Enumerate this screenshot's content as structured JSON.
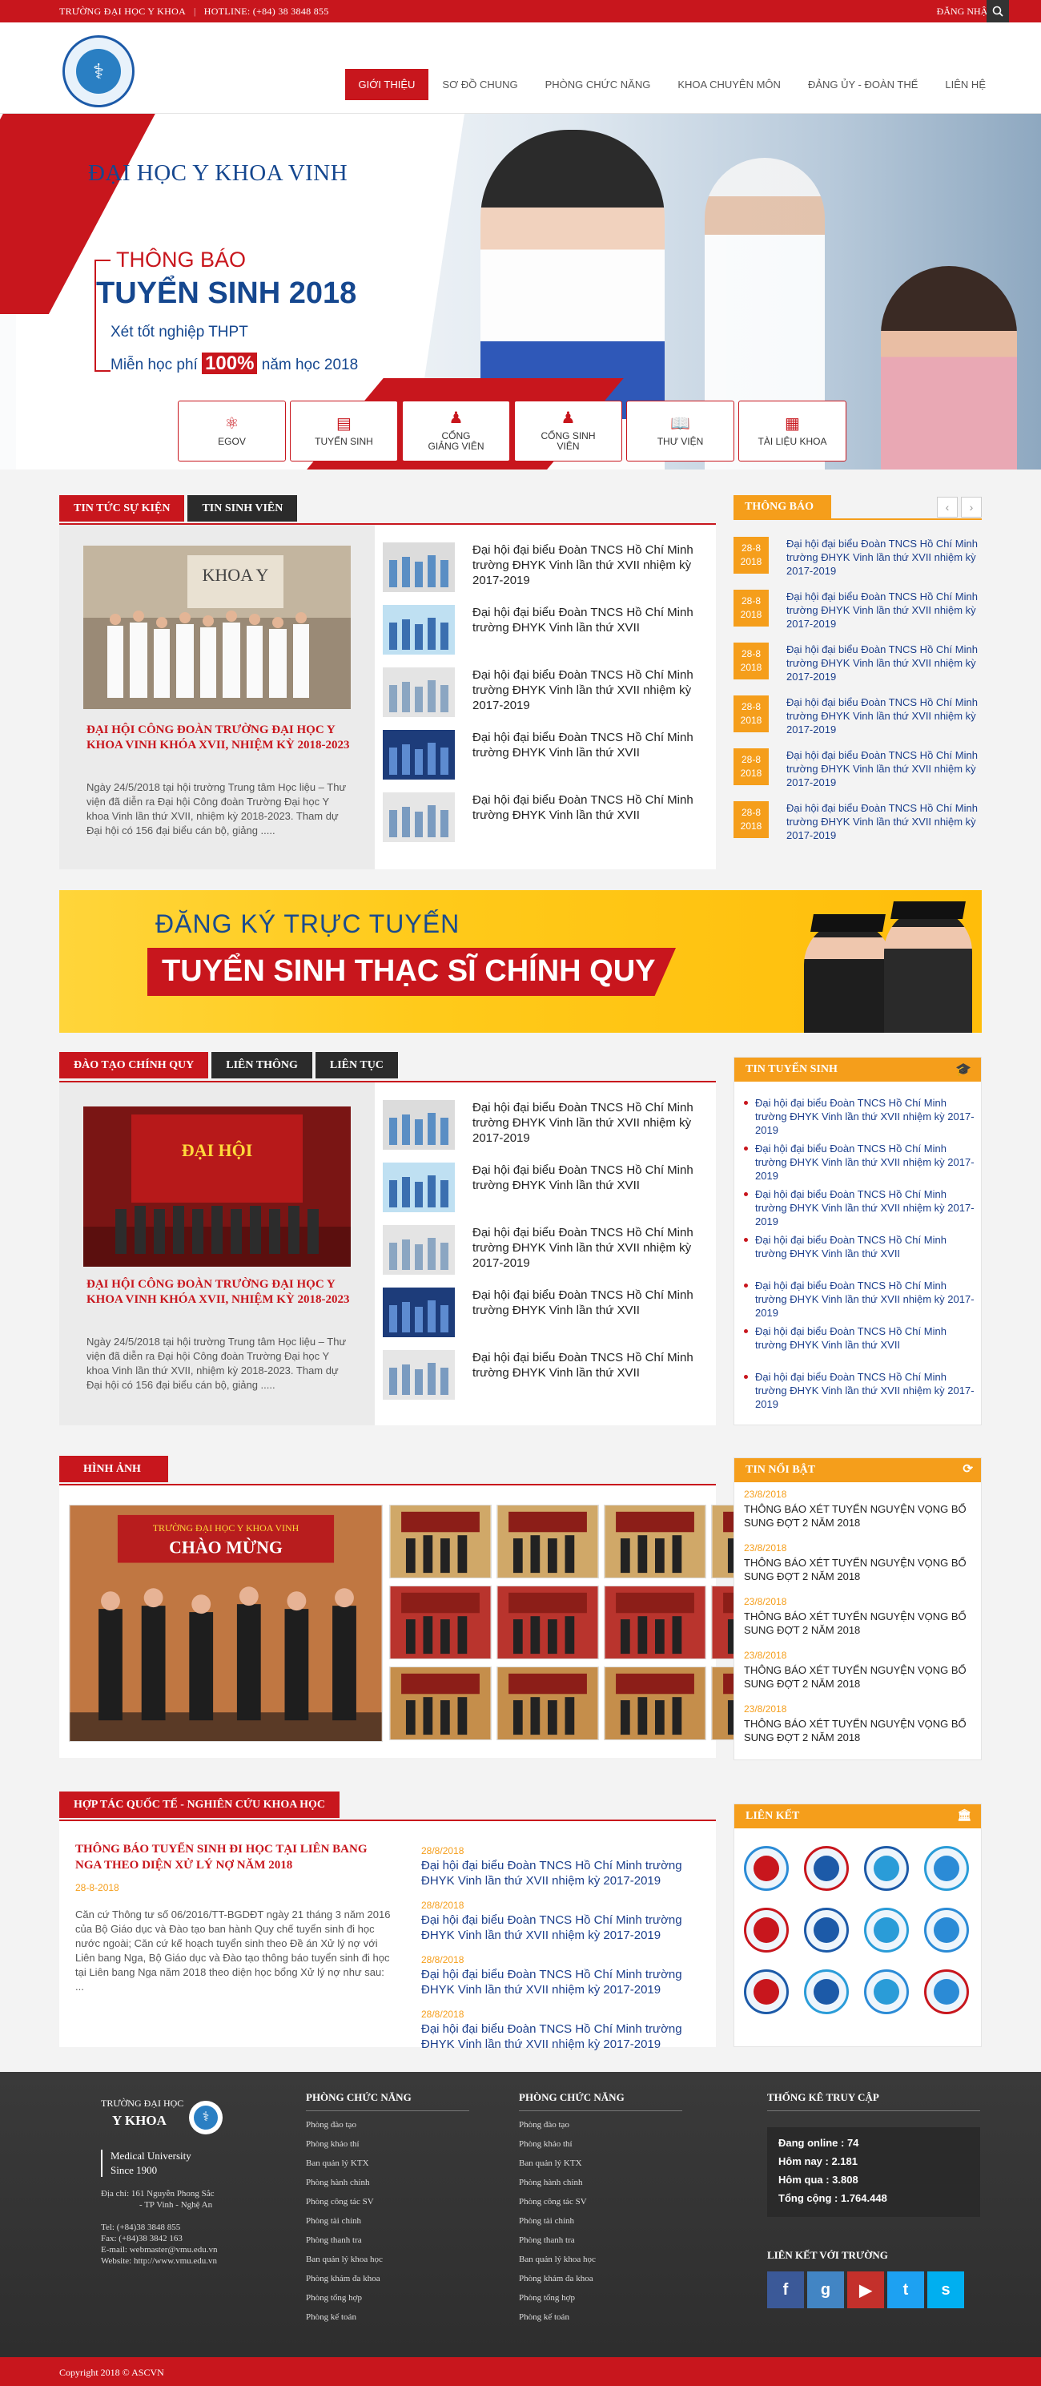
{
  "topbar": {
    "school": "TRƯỜNG ĐẠI HỌC Y KHOA",
    "hotline": "HOTLINE: (+84) 38 3848 855",
    "login": "ĐĂNG NHẬP"
  },
  "nav": [
    {
      "label": "Giới thiệu",
      "active": true
    },
    {
      "label": "Sơ đồ chung"
    },
    {
      "label": "Phòng chức năng"
    },
    {
      "label": "Khoa chuyên môn"
    },
    {
      "label": "Đảng ủy - Đoàn thể"
    },
    {
      "label": "Liên hệ"
    }
  ],
  "hero": {
    "school": "ĐẠI HỌC Y KHOA VINH",
    "notice": "THÔNG BÁO",
    "title": "TUYỂN SINH 2018",
    "line1": "Xét tốt nghiệp THPT",
    "line2_pre": "Miễn học phí ",
    "line2_hl": "100%",
    "line2_post": " năm học 2018"
  },
  "quick": [
    {
      "label": "EGOV",
      "icon": "atom-icon",
      "glyph": "⚛"
    },
    {
      "label": "TUYỂN SINH",
      "icon": "admission-icon",
      "glyph": "▤"
    },
    {
      "label": "CỔNG GIẢNG VIÊN",
      "icon": "teacher-icon",
      "glyph": "♟"
    },
    {
      "label": "CỔNG SINH VIÊN",
      "icon": "student-icon",
      "glyph": "♟"
    },
    {
      "label": "THƯ VIỆN",
      "icon": "book-icon",
      "glyph": "📖"
    },
    {
      "label": "TÀI LIỆU KHOA",
      "icon": "documents-icon",
      "glyph": "▦"
    }
  ],
  "news": {
    "tabs": [
      "TIN TỨC SỰ KIỆN",
      "TIN SINH VIÊN"
    ],
    "featured_title": "ĐẠI HỘI CÔNG ĐOÀN TRƯỜNG ĐẠI HỌC Y KHOA VINH KHÓA XVII, NHIỆM KỲ 2018-2023",
    "featured_desc": "Ngày 24/5/2018 tại hội trường Trung tâm Học liệu – Thư viện đã diễn ra Đại hội Công đoàn Trường Đại học Y khoa Vinh lần thứ XVII, nhiệm kỳ 2018-2023. Tham dự Đại hội có 156 đại biểu cán bộ, giảng .....",
    "items": [
      "Đại hội đại biểu Đoàn TNCS Hồ Chí Minh trường ĐHYK Vinh lần thứ XVII nhiệm kỳ 2017-2019",
      "Đại hội đại biểu Đoàn TNCS Hồ Chí Minh trường ĐHYK Vinh lần thứ XVII",
      "Đại hội đại biểu Đoàn TNCS Hồ Chí Minh trường ĐHYK Vinh lần thứ XVII nhiệm kỳ 2017-2019",
      "Đại hội đại biểu Đoàn TNCS Hồ Chí Minh trường ĐHYK Vinh lần thứ XVII",
      "Đại hội đại biểu Đoàn TNCS Hồ Chí Minh trường ĐHYK Vinh lần thứ XVII"
    ]
  },
  "thongbao": {
    "title": "THÔNG BÁO",
    "items": [
      {
        "d1": "28-8",
        "d2": "2018",
        "text": "Đại hội đại biểu Đoàn TNCS Hồ Chí Minh trường ĐHYK Vinh lần thứ XVII nhiệm kỳ 2017-2019"
      },
      {
        "d1": "28-8",
        "d2": "2018",
        "text": "Đại hội đại biểu Đoàn TNCS Hồ Chí Minh trường ĐHYK Vinh lần thứ XVII nhiệm kỳ 2017-2019"
      },
      {
        "d1": "28-8",
        "d2": "2018",
        "text": "Đại hội đại biểu Đoàn TNCS Hồ Chí Minh trường ĐHYK Vinh lần thứ XVII nhiệm kỳ 2017-2019"
      },
      {
        "d1": "28-8",
        "d2": "2018",
        "text": "Đại hội đại biểu Đoàn TNCS Hồ Chí Minh trường ĐHYK Vinh lần thứ XVII nhiệm kỳ 2017-2019"
      },
      {
        "d1": "28-8",
        "d2": "2018",
        "text": "Đại hội đại biểu Đoàn TNCS Hồ Chí Minh trường ĐHYK Vinh lần thứ XVII nhiệm kỳ 2017-2019"
      },
      {
        "d1": "28-8",
        "d2": "2018",
        "text": "Đại hội đại biểu Đoàn TNCS Hồ Chí Minh trường ĐHYK Vinh lần thứ XVII nhiệm kỳ 2017-2019"
      }
    ]
  },
  "banner": {
    "line1": "ĐĂNG KÝ TRỰC TUYẾN",
    "line2": "TUYỂN SINH THẠC SĨ CHÍNH QUY"
  },
  "training": {
    "tabs": [
      "ĐÀO TẠO CHÍNH QUY",
      "LIÊN THÔNG",
      "LIÊN TỤC"
    ],
    "featured_title": "ĐẠI HỘI CÔNG ĐOÀN TRƯỜNG ĐẠI HỌC Y KHOA VINH KHÓA XVII, NHIỆM KỲ 2018-2023",
    "featured_desc": "Ngày 24/5/2018 tại hội trường Trung tâm Học liệu – Thư viện đã diễn ra Đại hội Công đoàn Trường Đại học Y khoa Vinh lần thứ XVII, nhiệm kỳ 2018-2023. Tham dự Đại hội có 156 đại biểu cán bộ, giảng .....",
    "banner_caption": "ĐẠI HỘI",
    "items": [
      "Đại hội đại biểu Đoàn TNCS Hồ Chí Minh trường ĐHYK Vinh lần thứ XVII nhiệm kỳ 2017-2019",
      "Đại hội đại biểu Đoàn TNCS Hồ Chí Minh trường ĐHYK Vinh lần thứ XVII",
      "Đại hội đại biểu Đoàn TNCS Hồ Chí Minh trường ĐHYK Vinh lần thứ XVII nhiệm kỳ 2017-2019",
      "Đại hội đại biểu Đoàn TNCS Hồ Chí Minh trường ĐHYK Vinh lần thứ XVII",
      "Đại hội đại biểu Đoàn TNCS Hồ Chí Minh trường ĐHYK Vinh lần thứ XVII"
    ]
  },
  "tuyensinh": {
    "title": "TIN TUYỂN SINH",
    "items": [
      "Đại hội đại biểu Đoàn TNCS Hồ Chí Minh trường ĐHYK Vinh lần thứ XVII nhiệm kỳ 2017-2019",
      "Đại hội đại biểu Đoàn TNCS Hồ Chí Minh trường ĐHYK Vinh lần thứ XVII nhiệm kỳ 2017-2019",
      "Đại hội đại biểu Đoàn TNCS Hồ Chí Minh trường ĐHYK Vinh lần thứ XVII nhiệm kỳ 2017-2019",
      "Đại hội đại biểu Đoàn TNCS Hồ Chí Minh trường ĐHYK Vinh lần thứ XVII",
      "Đại hội đại biểu Đoàn TNCS Hồ Chí Minh trường ĐHYK Vinh lần thứ XVII nhiệm kỳ 2017-2019",
      "Đại hội đại biểu Đoàn TNCS Hồ Chí Minh trường ĐHYK Vinh lần thứ XVII",
      "Đại hội đại biểu Đoàn TNCS Hồ Chí Minh trường ĐHYK Vinh lần thứ XVII nhiệm kỳ 2017-2019"
    ]
  },
  "gallery": {
    "title": "HÌNH ẢNH",
    "main_caption1": "TRƯỜNG ĐẠI HỌC Y KHOA VINH",
    "main_caption2": "CHÀO MỪNG"
  },
  "noibat": {
    "title": "TIN NỔI BẬT",
    "items": [
      {
        "date": "23/8/2018",
        "text": "THÔNG BÁO XÉT TUYỂN NGUYỆN VỌNG BỔ SUNG  ĐỢT 2 NĂM 2018"
      },
      {
        "date": "23/8/2018",
        "text": "THÔNG BÁO XÉT TUYỂN NGUYỆN VỌNG BỔ SUNG  ĐỢT 2 NĂM 2018"
      },
      {
        "date": "23/8/2018",
        "text": "THÔNG BÁO XÉT TUYỂN NGUYỆN VỌNG BỔ SUNG  ĐỢT 2 NĂM 2018"
      },
      {
        "date": "23/8/2018",
        "text": "THÔNG BÁO XÉT TUYỂN NGUYỆN VỌNG BỔ SUNG  ĐỢT 2 NĂM 2018"
      },
      {
        "date": "23/8/2018",
        "text": "THÔNG BÁO XÉT TUYỂN NGUYỆN VỌNG BỔ SUNG  ĐỢT 2 NĂM 2018"
      }
    ]
  },
  "research": {
    "title": "HỢP TÁC QUỐC TẾ - NGHIÊN CỨU KHOA HỌC",
    "featured_title": "THÔNG BÁO TUYỂN SINH ĐI HỌC TẠI LIÊN BANG NGA THEO DIỆN XỬ LÝ NỢ NĂM 2018",
    "featured_date": "28-8-2018",
    "featured_desc": "Căn cứ Thông tư số 06/2016/TT-BGDĐT ngày 21 tháng 3 năm 2016 của Bộ Giáo dục và Đào tạo ban hành Quy chế tuyển sinh đi học nước ngoài; Căn cứ kế hoạch tuyển sinh theo Đề án Xử lý nợ với Liên bang Nga, Bộ Giáo dục và Đào tạo thông báo tuyển sinh đi học tại Liên bang Nga năm 2018 theo diện học bổng Xử lý nợ như sau: ...",
    "items": [
      {
        "date": "28/8/2018",
        "text": "Đại hội đại biểu Đoàn TNCS Hồ Chí Minh trường ĐHYK Vinh lần thứ XVII nhiệm kỳ 2017-2019"
      },
      {
        "date": "28/8/2018",
        "text": "Đại hội đại biểu Đoàn TNCS Hồ Chí Minh trường ĐHYK Vinh lần thứ XVII nhiệm kỳ 2017-2019"
      },
      {
        "date": "28/8/2018",
        "text": "Đại hội đại biểu Đoàn TNCS Hồ Chí Minh trường ĐHYK Vinh lần thứ XVII nhiệm kỳ 2017-2019"
      },
      {
        "date": "28/8/2018",
        "text": "Đại hội đại biểu Đoàn TNCS Hồ Chí Minh trường ĐHYK Vinh lần thứ XVII nhiệm kỳ 2017-2019"
      }
    ]
  },
  "lienket": {
    "title": "LIÊN KẾT"
  },
  "footer": {
    "brand1": "TRƯỜNG ĐẠI HỌC",
    "brand2": "Y KHOA",
    "brand3": "Medical University",
    "brand4": "Since 1900",
    "addr1": "Địa chỉ: 161 Nguyễn Phong Sắc",
    "addr2": "- TP Vinh - Nghệ An",
    "tel": "Tel: (+84)38 3848 855",
    "fax": "Fax: (+84)38 3842 163",
    "email": "E-mail: webmaster@vmu.edu.vn",
    "web": "Website: http://www.vmu.edu.vn",
    "col1_title": "PHÒNG CHỨC NĂNG",
    "col2_title": "PHÒNG CHỨC NĂNG",
    "links": [
      "Phòng đào tạo",
      "Phòng khảo thí",
      "Ban quản lý KTX",
      "Phòng hành chính",
      "Phòng công tác SV",
      "Phòng tài chính",
      "Phòng thanh tra",
      "Ban quản lý khoa học",
      "Phòng khám đa khoa",
      "Phòng tổng hợp",
      "Phòng kế toán"
    ],
    "stats_title": "THỐNG KÊ TRUY CẬP",
    "stats": [
      "Đang online : 74",
      "Hôm nay : 2.181",
      "Hôm qua : 3.808",
      "Tổng cộng : 1.764.448"
    ],
    "social_title": "LIÊN KẾT VỚI TRƯỜNG",
    "social": [
      {
        "name": "facebook-icon",
        "glyph": "f",
        "color": "#3b5998"
      },
      {
        "name": "google-icon",
        "glyph": "g",
        "color": "#4285c4"
      },
      {
        "name": "youtube-icon",
        "glyph": "▶",
        "color": "#c4302b"
      },
      {
        "name": "twitter-icon",
        "glyph": "t",
        "color": "#1da1f2"
      },
      {
        "name": "skype-icon",
        "glyph": "s",
        "color": "#00aff0"
      }
    ]
  },
  "copyright": "Copyright  2018 © ASCVN",
  "colors": {
    "primary": "#c8161d",
    "accent": "#f59e1b",
    "dark": "#2b2b2b",
    "navy": "#15478f"
  }
}
